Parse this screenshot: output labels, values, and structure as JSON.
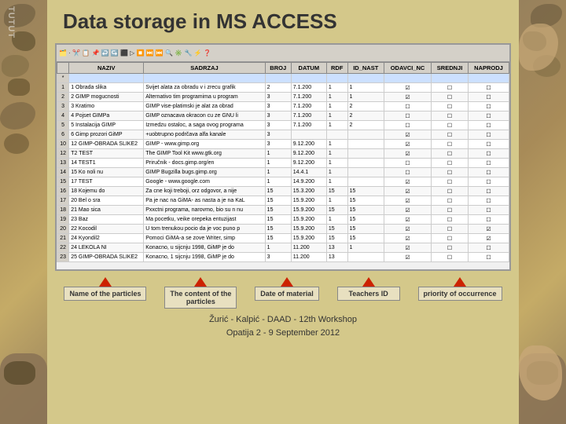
{
  "title": "Data storage in MS ACCESS",
  "annotations": [
    {
      "id": "name-of-particles",
      "label": "Name of the particles"
    },
    {
      "id": "content-of-particles",
      "label": "The content of the\nparticles"
    },
    {
      "id": "date-of-material",
      "label": "Date of material"
    },
    {
      "id": "teachers-id",
      "label": "Teachers ID"
    },
    {
      "id": "priority-of-occurrence",
      "label": "priority of occurrence"
    }
  ],
  "footer": {
    "line1": "Žurić - Kalpić - DAAD - 12th Workshop",
    "line2": "Opatija 2 - 9 September 2012"
  },
  "table": {
    "headers": [
      "",
      "NAZIV",
      "SADRZAJ",
      "BROJ",
      "DATUM",
      "RDF",
      "ID_NAST",
      "ODAVCI_NC",
      "SREDNJI",
      "NAPRODJ"
    ],
    "rows": [
      [
        "*",
        "",
        "",
        "",
        "",
        "",
        "",
        "",
        "",
        ""
      ],
      [
        "1",
        "1 Obrada slika",
        "Svijet alata za obradu v i zrecu grafik",
        "2",
        "7.1.200",
        "1",
        "1",
        "☑",
        "☐",
        "☐"
      ],
      [
        "2",
        "2 GIMP mogucnosti",
        "Alternativo tim programima u program",
        "3",
        "7.1.200",
        "1",
        "1",
        "☑",
        "☐",
        "☐"
      ],
      [
        "3",
        "3 Kratimo",
        "GIMP vise-platimski je alat za obrad",
        "3",
        "7.1.200",
        "1",
        "2",
        "☐",
        "☐",
        "☐"
      ],
      [
        "4",
        "4 Pojset GIMPa",
        "GIMP oznacava okracon cu ze GNU li",
        "3",
        "7.1.200",
        "1",
        "2",
        "☐",
        "☐",
        "☐"
      ],
      [
        "5",
        "5 Instalacija GIMP",
        "Izmedzu ostaloc, a saga ovog programa",
        "3",
        "7.1.200",
        "1",
        "2",
        "☐",
        "☐",
        "☐"
      ],
      [
        "6",
        "6 Gimp prozori GiMP",
        "+uobtrupno podrčava alfa kanale",
        "3",
        "",
        "",
        "",
        "☑",
        "☐",
        "☐"
      ],
      [
        "10",
        "12 GIMP-OBRADA SLIKE2",
        "GIMP - www.gimp.org",
        "3",
        "9.12.200",
        "1",
        "",
        "☑",
        "☐",
        "☐"
      ],
      [
        "12",
        "T2 TEST",
        "The GIMP Tool Kit www.gtk.org",
        "1",
        "9.12.200",
        "1",
        "",
        "☑",
        "☐",
        "☐"
      ],
      [
        "13",
        "14 TEST1",
        "Priručnik - docs.gimp.org/en",
        "1",
        "9.12.200",
        "1",
        "",
        "☐",
        "☐",
        "☐"
      ],
      [
        "14",
        "15 Ko noli nu",
        "GIMP Bugzilla  bugs.gimp.org",
        "1",
        "14.4.1",
        "1",
        "",
        "☐",
        "☐",
        "☐"
      ],
      [
        "15",
        "17 TEST",
        "Google - www.google.com",
        "1",
        "14.9.200",
        "1",
        "",
        "☑",
        "☐",
        "☐"
      ],
      [
        "16",
        "18 Kojemu do",
        "Za cne koji treboji, orz odgovor, a nije",
        "15",
        "15.3.200",
        "15",
        "15",
        "☑",
        "☐",
        "☐"
      ],
      [
        "17",
        "20 Bel o sra",
        "Pa je nac na GiMA- as nasta a je na KaL",
        "15",
        "15.9.200",
        "1",
        "15",
        "☑",
        "☐",
        "☐"
      ],
      [
        "18",
        "21 Mao sica",
        "Pxxctni programa, narovmo, bio su n nu",
        "15",
        "15.9.200",
        "15",
        "15",
        "☑",
        "☐",
        "☐"
      ],
      [
        "19",
        "23 Baz",
        "Ma pocetku, veike orepeka entuzijast",
        "15",
        "15.9.200",
        "1",
        "15",
        "☑",
        "☐",
        "☐"
      ],
      [
        "20",
        "22 Kocodil",
        "U tom trenukou pocio da je voc puno p",
        "15",
        "15.9.200",
        "15",
        "15",
        "☑",
        "☐",
        "☑"
      ],
      [
        "21",
        "24 Kyondil2",
        "Pomoci GiMA-a se zove Writer, simp",
        "15",
        "15.9.200",
        "15",
        "15",
        "☑",
        "☐",
        "☑"
      ],
      [
        "22",
        "24 LEKOLA NI",
        "Konacno, u sijcnju 1998, GiMP je do",
        "1",
        "11.200",
        "13",
        "1",
        "☑",
        "☐",
        "☐"
      ],
      [
        "23",
        "25 GIMP-OBRADA SLIKE2",
        "Konacno, 1 sijcnju 1998, GiMP je do",
        "3",
        "11.200",
        "13",
        "",
        "☑",
        "☐",
        "☐"
      ]
    ]
  }
}
